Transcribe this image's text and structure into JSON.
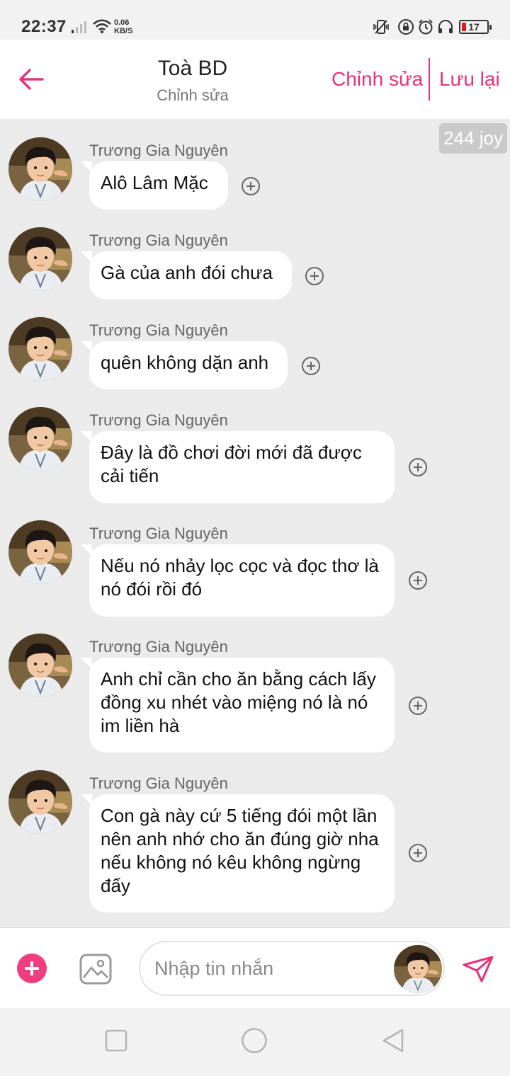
{
  "status_bar": {
    "time": "22:37",
    "net_speed_value": "0.06",
    "net_speed_unit": "KB/S",
    "battery_level": "17",
    "icons": [
      "signal-icon",
      "wifi-icon",
      "vibrate-icon",
      "lock-rotation-icon",
      "alarm-icon",
      "headset-icon",
      "battery-icon"
    ]
  },
  "header": {
    "title": "Toà BD",
    "subtitle": "Chỉnh sửa",
    "edit_label": "Chỉnh sửa",
    "save_label": "Lưu lại"
  },
  "badge": {
    "joy": "244 joy"
  },
  "messages": [
    {
      "sender": "Trương Gia Nguyên",
      "text": "Alô Lâm Mặc"
    },
    {
      "sender": "Trương Gia Nguyên",
      "text": "Gà của anh đói chưa"
    },
    {
      "sender": "Trương Gia Nguyên",
      "text": "quên không dặn anh"
    },
    {
      "sender": "Trương Gia Nguyên",
      "text": "Đây là đồ chơi đời mới đã được cải tiến"
    },
    {
      "sender": "Trương Gia Nguyên",
      "text": "Nếu nó nhảy lọc cọc và đọc thơ là nó đói rồi đó"
    },
    {
      "sender": "Trương Gia Nguyên",
      "text": "Anh chỉ cần cho ăn bằng cách lấy đồng xu nhét vào miệng nó là nó im liền hà"
    },
    {
      "sender": "Trương Gia Nguyên",
      "text": "Con gà này cứ 5 tiếng đói một lần nên anh nhớ cho ăn đúng giờ nha nếu không nó kêu không ngừng đấy"
    }
  ],
  "composer": {
    "placeholder": "Nhập tin nhắn"
  },
  "colors": {
    "accent": "#e8317b",
    "add_button": "#ef3d7e",
    "battery_low": "#e21b1b"
  }
}
